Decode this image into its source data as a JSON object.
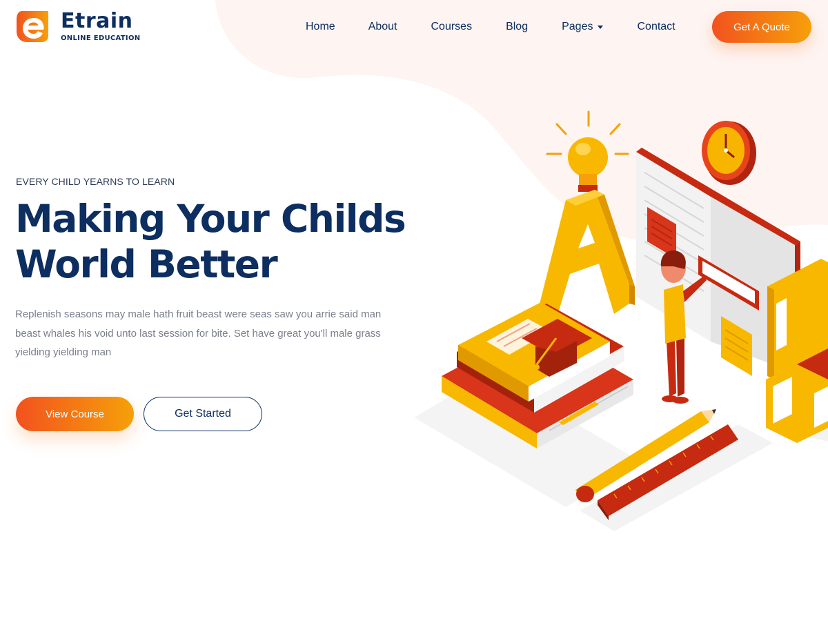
{
  "colors": {
    "navy": "#0c2e60",
    "accent_start": "#f2521e",
    "accent_end": "#f6a00a",
    "blob": "#fef4f2",
    "body_text": "#7a7f8c"
  },
  "header": {
    "logo": {
      "name": "Etrain",
      "tagline": "ONLINE EDUCATION",
      "icon": "etrain-logo-icon"
    },
    "nav": {
      "home": "Home",
      "about": "About",
      "courses": "Courses",
      "blog": "Blog",
      "pages": "Pages",
      "contact": "Contact"
    },
    "cta": "Get A Quote"
  },
  "hero": {
    "eyebrow": "EVERY CHILD YEARNS TO LEARN",
    "title_line1": "Making Your Childs",
    "title_line2": "World Better",
    "description": "Replenish seasons may male hath fruit beast were seas saw you arrie said man beast whales his void unto last session for bite. Set have great you'll male grass yielding yielding man",
    "primary_button": "View Course",
    "secondary_button": "Get Started",
    "illustration": "isometric-education-illustration"
  }
}
